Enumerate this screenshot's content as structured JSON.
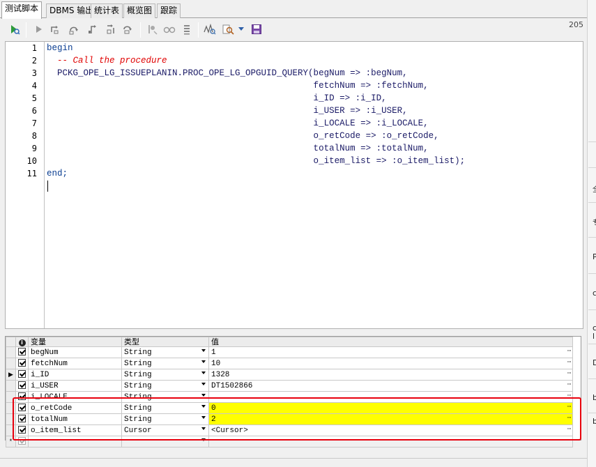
{
  "tabs": [
    {
      "label": "测试脚本",
      "active": true
    },
    {
      "label": "DBMS 输出",
      "active": false
    },
    {
      "label": "统计表",
      "active": false
    },
    {
      "label": "概览图",
      "active": false
    },
    {
      "label": "跟踪",
      "active": false
    }
  ],
  "toolbar": {
    "line_count": "205",
    "icons": [
      "execute-icon",
      "run-icon",
      "step-into-icon",
      "step-over-icon",
      "step-out-icon",
      "run-to-exception-icon",
      "run-to-cursor-icon",
      "toggle-breakpoint-icon",
      "watch-icon",
      "call-stack-icon",
      "compile-icon",
      "find-icon",
      "dropdown-arrow-icon",
      "save-icon"
    ]
  },
  "editor": {
    "line_numbers": [
      "1",
      "2",
      "3",
      "4",
      "5",
      "6",
      "7",
      "8",
      "9",
      "10",
      "11"
    ],
    "lines": [
      {
        "text": "begin",
        "style": "kw"
      },
      {
        "text": "  -- Call the procedure",
        "style": "comment"
      },
      {
        "text": "  PCKG_OPE_LG_ISSUEPLANIN.PROC_OPE_LG_OPGUID_QUERY(begNum => :begNum,",
        "style": "plain"
      },
      {
        "text": "                                                   fetchNum => :fetchNum,",
        "style": "plain"
      },
      {
        "text": "                                                   i_ID => :i_ID,",
        "style": "plain"
      },
      {
        "text": "                                                   i_USER => :i_USER,",
        "style": "plain"
      },
      {
        "text": "                                                   i_LOCALE => :i_LOCALE,",
        "style": "plain"
      },
      {
        "text": "                                                   o_retCode => :o_retCode,",
        "style": "plain"
      },
      {
        "text": "                                                   totalNum => :totalNum,",
        "style": "plain"
      },
      {
        "text": "                                                   o_item_list => :o_item_list);",
        "style": "plain"
      },
      {
        "text": "end;",
        "style": "kw"
      }
    ]
  },
  "grid": {
    "headers": {
      "info": "i",
      "variable": "变量",
      "type": "类型",
      "value": "值"
    },
    "rows": [
      {
        "name": "begNum",
        "type": "String",
        "value": "1",
        "checked": true,
        "current": false,
        "highlight": false
      },
      {
        "name": "fetchNum",
        "type": "String",
        "value": "10",
        "checked": true,
        "current": false,
        "highlight": false
      },
      {
        "name": "i_ID",
        "type": "String",
        "value": "1328",
        "checked": true,
        "current": true,
        "highlight": false
      },
      {
        "name": "i_USER",
        "type": "String",
        "value": "DT1502866",
        "checked": true,
        "current": false,
        "highlight": false
      },
      {
        "name": "i_LOCALE",
        "type": "String",
        "value": "",
        "checked": true,
        "current": false,
        "highlight": false
      },
      {
        "name": "o_retCode",
        "type": "String",
        "value": "0",
        "checked": true,
        "current": false,
        "highlight": true
      },
      {
        "name": "totalNum",
        "type": "String",
        "value": "2",
        "checked": true,
        "current": false,
        "highlight": true
      },
      {
        "name": "o_item_list",
        "type": "Cursor",
        "value": "<Cursor>",
        "checked": true,
        "current": false,
        "highlight": false
      },
      {
        "name": "",
        "type": "",
        "value": "",
        "checked": true,
        "current": false,
        "highlight": false,
        "new_row": true
      }
    ],
    "ellipsis": "···",
    "new_row_marker": "*",
    "current_row_marker": "▶"
  },
  "right_panel": {
    "letters": [
      "全",
      "专",
      "P",
      "c",
      "c",
      "l",
      "D",
      "b",
      "b"
    ]
  },
  "colors": {
    "highlight": "#ffff00",
    "annotation_box": "#e8000d",
    "keyword": "#0a3d91",
    "comment": "#e00000"
  }
}
